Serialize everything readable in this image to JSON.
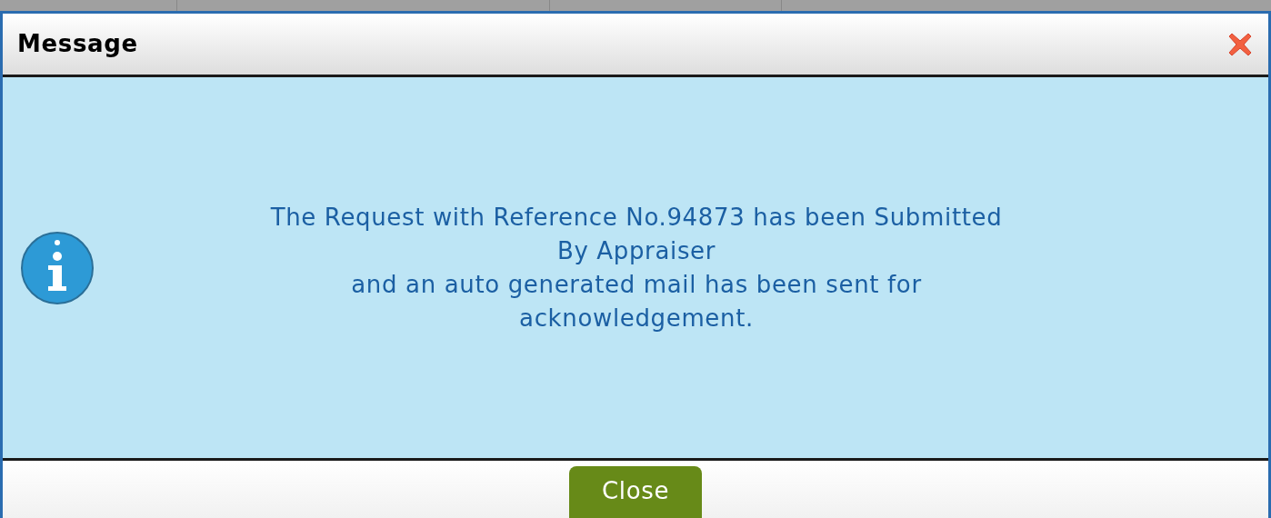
{
  "dialog": {
    "title": "Message",
    "message_lines": [
      "The Request with Reference No.94873 has been Submitted",
      "By Appraiser",
      "and an auto generated mail has been sent for",
      "acknowledgement."
    ],
    "buttons": [
      "Close"
    ]
  }
}
